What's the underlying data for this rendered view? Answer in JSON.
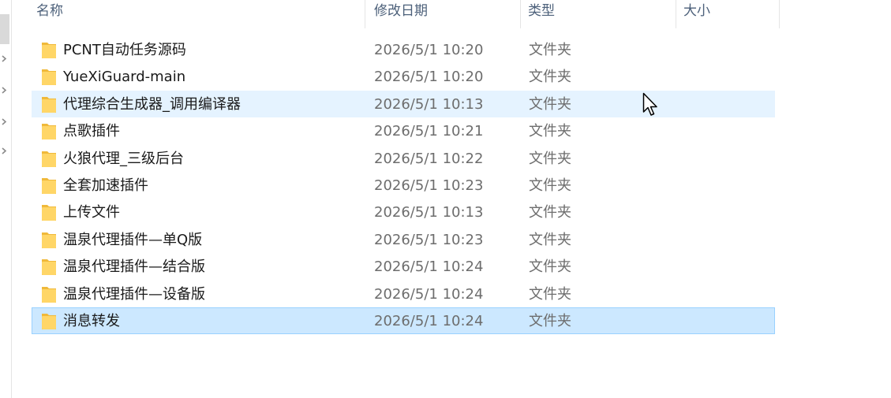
{
  "columns": {
    "name": "名称",
    "modified": "修改日期",
    "type": "类型",
    "size": "大小"
  },
  "files": [
    {
      "name": "PCNT自动任务源码",
      "modified": "2026/5/1 10:20",
      "type": "文件夹"
    },
    {
      "name": "YueXiGuard-main",
      "modified": "2026/5/1 10:20",
      "type": "文件夹"
    },
    {
      "name": "代理综合生成器_调用编译器",
      "modified": "2026/5/1 10:13",
      "type": "文件夹",
      "state": "hover"
    },
    {
      "name": "点歌插件",
      "modified": "2026/5/1 10:21",
      "type": "文件夹"
    },
    {
      "name": "火狼代理_三级后台",
      "modified": "2026/5/1 10:22",
      "type": "文件夹"
    },
    {
      "name": "全套加速插件",
      "modified": "2026/5/1 10:23",
      "type": "文件夹"
    },
    {
      "name": "上传文件",
      "modified": "2026/5/1 10:13",
      "type": "文件夹"
    },
    {
      "name": "温泉代理插件—单Q版",
      "modified": "2026/5/1 10:23",
      "type": "文件夹"
    },
    {
      "name": "温泉代理插件—结合版",
      "modified": "2026/5/1 10:24",
      "type": "文件夹"
    },
    {
      "name": "温泉代理插件—设备版",
      "modified": "2026/5/1 10:24",
      "type": "文件夹"
    },
    {
      "name": "消息转发",
      "modified": "2026/5/1 10:24",
      "type": "文件夹",
      "state": "selected"
    }
  ],
  "icons": {
    "folder": "folder-icon",
    "cursor": "mouse-pointer-icon",
    "nav_expand": "chevron-right-icon"
  },
  "colors": {
    "folder_fill": "#ffd667",
    "folder_tab": "#f0b93a",
    "hover_bg": "#e5f3ff",
    "selected_bg": "#cce8ff",
    "selected_border": "#99d1ff",
    "header_text": "#4c607a"
  }
}
